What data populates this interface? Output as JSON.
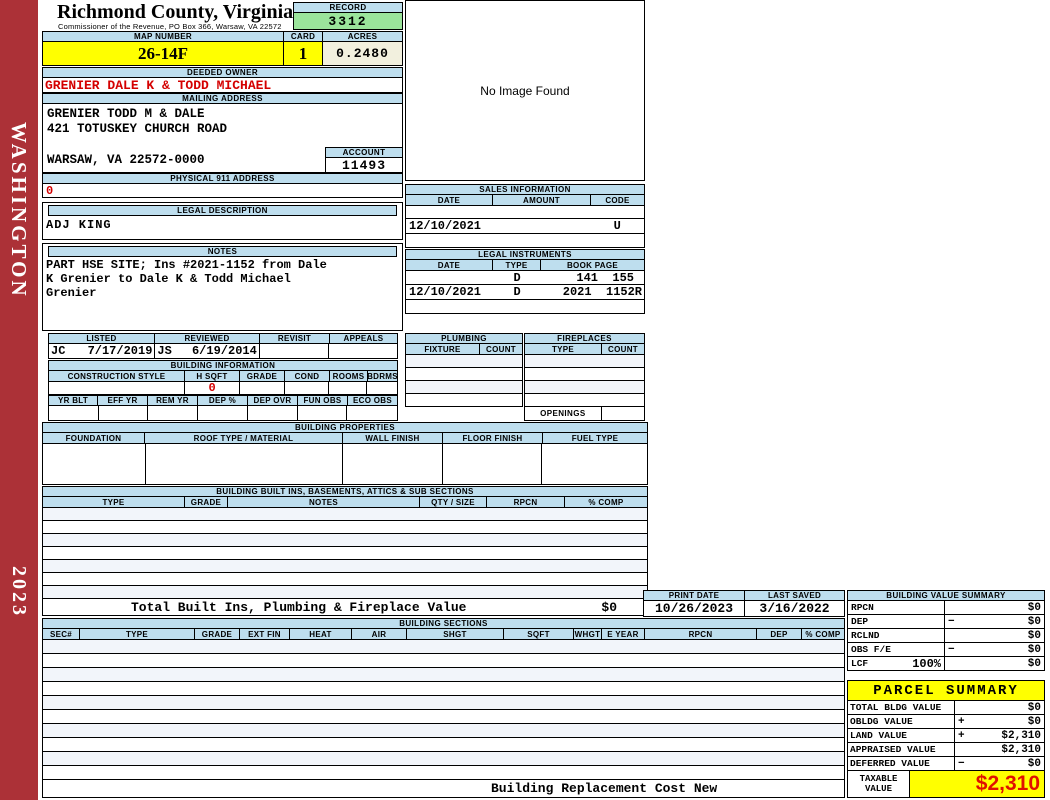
{
  "county": {
    "name": "Richmond County, Virginia",
    "office": "Commissioner of the Revenue, PO Box 366, Warsaw, VA 22572"
  },
  "sidebar": {
    "district": "WASHINGTON",
    "year": "2023"
  },
  "record": {
    "label": "RECORD",
    "number": "3312"
  },
  "parcel_header": {
    "map_number_label": "MAP NUMBER",
    "map_number": "26-14F",
    "card_label": "CARD",
    "card": "1",
    "acres_label": "ACRES",
    "acres": "0.2480"
  },
  "owner": {
    "deeded_owner_label": "DEEDED OWNER",
    "deeded_owner": "GRENIER DALE K & TODD MICHAEL",
    "mailing_address_label": "MAILING ADDRESS",
    "mailing_line1": "GRENIER TODD M & DALE",
    "mailing_line2": "421 TOTUSKEY CHURCH ROAD",
    "mailing_line3": "WARSAW, VA 22572-0000",
    "account_label": "ACCOUNT",
    "account_number": "11493",
    "physical_address_label": "PHYSICAL 911 ADDRESS",
    "physical_address": "0"
  },
  "legal_description": {
    "label": "LEGAL DESCRIPTION",
    "value": "ADJ KING"
  },
  "notes": {
    "label": "NOTES",
    "line1": "PART HSE SITE; Ins #2021-1152 from Dale",
    "line2": "K Grenier to Dale K & Todd Michael",
    "line3": "Grenier"
  },
  "review": {
    "listed_label": "LISTED",
    "reviewed_label": "REVIEWED",
    "revisit_label": "REVISIT",
    "appeals_label": "APPEALS",
    "listed_by": "JC",
    "listed_date": "7/17/2019",
    "reviewed_by": "JS",
    "reviewed_date": "6/19/2014",
    "revisit": "",
    "appeals": ""
  },
  "building_information": {
    "label": "BUILDING INFORMATION",
    "row1_headers": [
      "CONSTRUCTION STYLE",
      "H SQFT",
      "GRADE",
      "COND",
      "ROOMS",
      "BDRMS"
    ],
    "h_sqft": "0",
    "row2_headers": [
      "YR BLT",
      "EFF YR",
      "REM YR",
      "DEP %",
      "DEP OVR",
      "FUN OBS",
      "ECO OBS"
    ]
  },
  "image_panel": {
    "placeholder": "No Image Found"
  },
  "sales_information": {
    "label": "SALES INFORMATION",
    "headers": [
      "DATE",
      "AMOUNT",
      "CODE"
    ],
    "rows": [
      {
        "date": "",
        "amount": "",
        "code": ""
      },
      {
        "date": "12/10/2021",
        "amount": "",
        "code": "U"
      },
      {
        "date": "",
        "amount": "",
        "code": ""
      }
    ]
  },
  "legal_instruments": {
    "label": "LEGAL INSTRUMENTS",
    "headers": [
      "DATE",
      "TYPE",
      "BOOK PAGE"
    ],
    "rows": [
      {
        "date": "",
        "type": "D",
        "book_page": "141  155"
      },
      {
        "date": "12/10/2021",
        "type": "D",
        "book_page": "2021  1152R"
      },
      {
        "date": "",
        "type": "",
        "book_page": ""
      }
    ]
  },
  "plumbing": {
    "label": "PLUMBING",
    "fixture_label": "FIXTURE",
    "count_label": "COUNT"
  },
  "fireplaces": {
    "label": "FIREPLACES",
    "type_label": "TYPE",
    "count_label": "COUNT",
    "openings_label": "OPENINGS"
  },
  "building_properties": {
    "label": "BUILDING PROPERTIES",
    "headers": [
      "FOUNDATION",
      "ROOF TYPE / MATERIAL",
      "WALL FINISH",
      "FLOOR FINISH",
      "FUEL TYPE"
    ]
  },
  "built_ins": {
    "label": "BUILDING BUILT INS, BASEMENTS, ATTICS & SUB SECTIONS",
    "headers": [
      "TYPE",
      "GRADE",
      "NOTES",
      "QTY / SIZE",
      "RPCN",
      "% COMP"
    ],
    "total_label": "Total Built Ins, Plumbing & Fireplace Value",
    "total_value": "$0"
  },
  "print_info": {
    "print_date_label": "PRINT DATE",
    "print_date": "10/26/2023",
    "last_saved_label": "LAST SAVED",
    "last_saved": "3/16/2022"
  },
  "building_value_summary": {
    "label": "BUILDING VALUE SUMMARY",
    "rows": [
      {
        "label": "RPCN",
        "pct": "",
        "op": "",
        "value": "$0"
      },
      {
        "label": "DEP",
        "pct": "",
        "op": "−",
        "value": "$0"
      },
      {
        "label": "RCLND",
        "pct": "",
        "op": "",
        "value": "$0"
      },
      {
        "label": "OBS F/E",
        "pct": "",
        "op": "−",
        "value": "$0"
      },
      {
        "label": "LCF",
        "pct": "100%",
        "op": "",
        "value": "$0"
      }
    ]
  },
  "building_sections": {
    "label": "BUILDING SECTIONS",
    "headers": [
      "SEC#",
      "TYPE",
      "GRADE",
      "EXT FIN",
      "HEAT",
      "AIR",
      "SHGT",
      "SQFT",
      "WHGT",
      "E YEAR",
      "RPCN",
      "DEP",
      "% COMP"
    ]
  },
  "parcel_summary": {
    "label": "PARCEL SUMMARY",
    "rows": [
      {
        "label": "TOTAL BLDG VALUE",
        "op": "",
        "value": "$0"
      },
      {
        "label": "OBLDG VALUE",
        "op": "+",
        "value": "$0"
      },
      {
        "label": "LAND VALUE",
        "op": "+",
        "value": "$2,310"
      },
      {
        "label": "APPRAISED VALUE",
        "op": "",
        "value": "$2,310"
      },
      {
        "label": "DEFERRED VALUE",
        "op": "−",
        "value": "$0"
      }
    ],
    "taxable_label_line1": "TAXABLE",
    "taxable_label_line2": "VALUE",
    "taxable_value": "$2,310"
  },
  "footer": {
    "text": "Building Replacement Cost New"
  },
  "colors": {
    "sidebar_red": "#AC3137",
    "header_blue": "#BEDEEE",
    "record_green": "#9BE49B",
    "highlight_yellow": "#FFFF00",
    "acres_cream": "#F2F0DE",
    "alert_red": "#D40000",
    "taxable_red": "#E01000"
  }
}
